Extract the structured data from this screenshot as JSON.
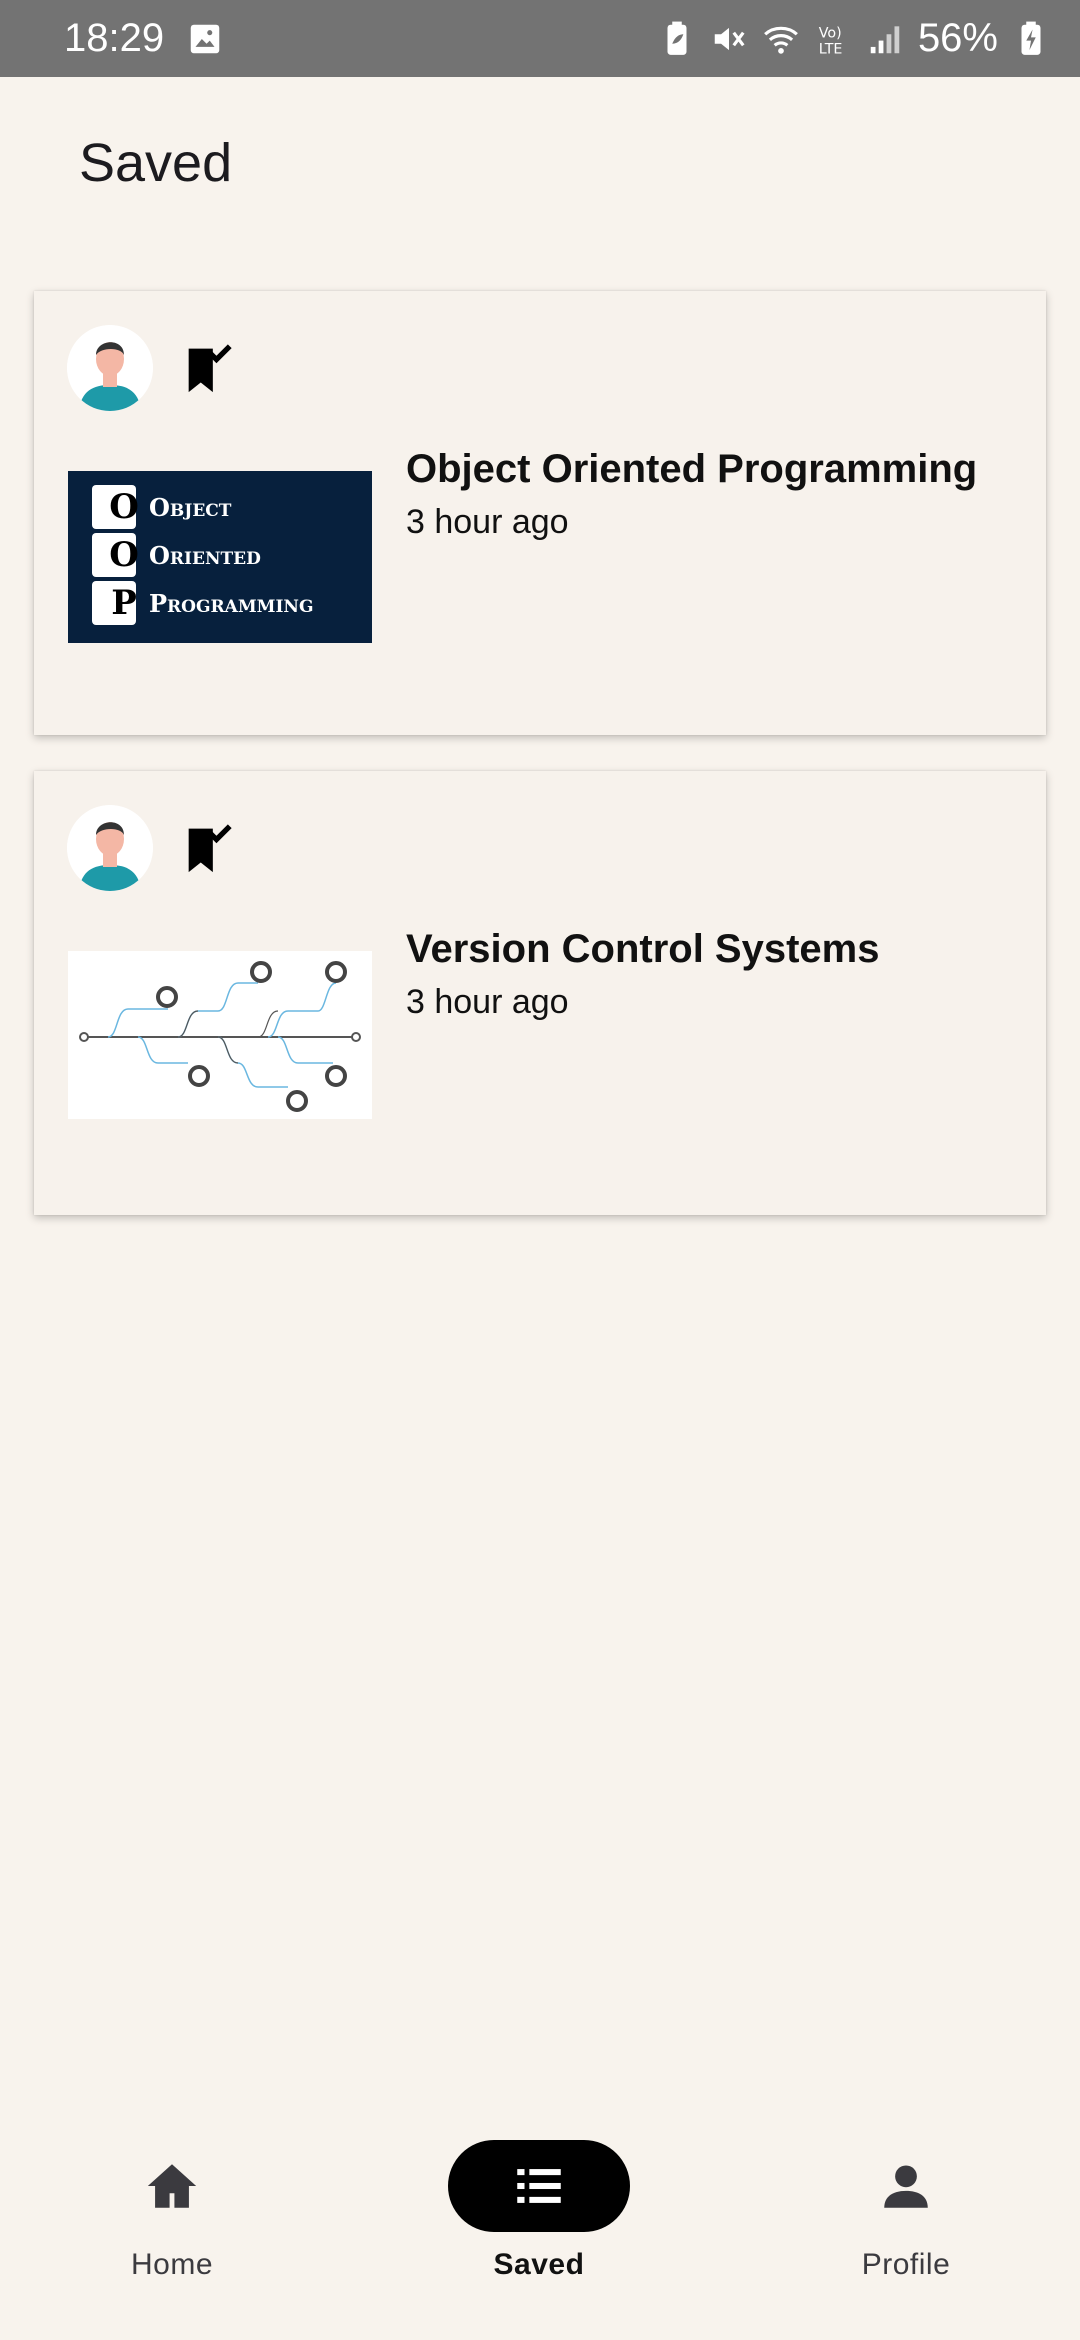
{
  "status_bar": {
    "time": "18:29",
    "battery": "56%",
    "icons": [
      "gallery-icon",
      "battery-saver-icon",
      "mute-icon",
      "wifi-icon",
      "volte-icon",
      "signal-icon",
      "battery-charging-icon"
    ]
  },
  "page": {
    "title": "Saved"
  },
  "cards": [
    {
      "title": "Object Oriented Programming",
      "time": "3 hour ago",
      "thumbnail": {
        "letters": [
          "O",
          "O",
          "P"
        ],
        "words": [
          "Object",
          "Oriented",
          "Programming"
        ]
      }
    },
    {
      "title": "Version Control Systems",
      "time": "3 hour ago"
    }
  ],
  "bottom_nav": {
    "items": [
      {
        "label": "Home",
        "icon": "home-icon"
      },
      {
        "label": "Saved",
        "icon": "list-icon",
        "active": true
      },
      {
        "label": "Profile",
        "icon": "person-icon"
      }
    ]
  },
  "colors": {
    "background": "#f8f3ed",
    "status_bar": "#737373",
    "active_pill": "#000000",
    "oop_thumb_bg": "#07203d"
  }
}
